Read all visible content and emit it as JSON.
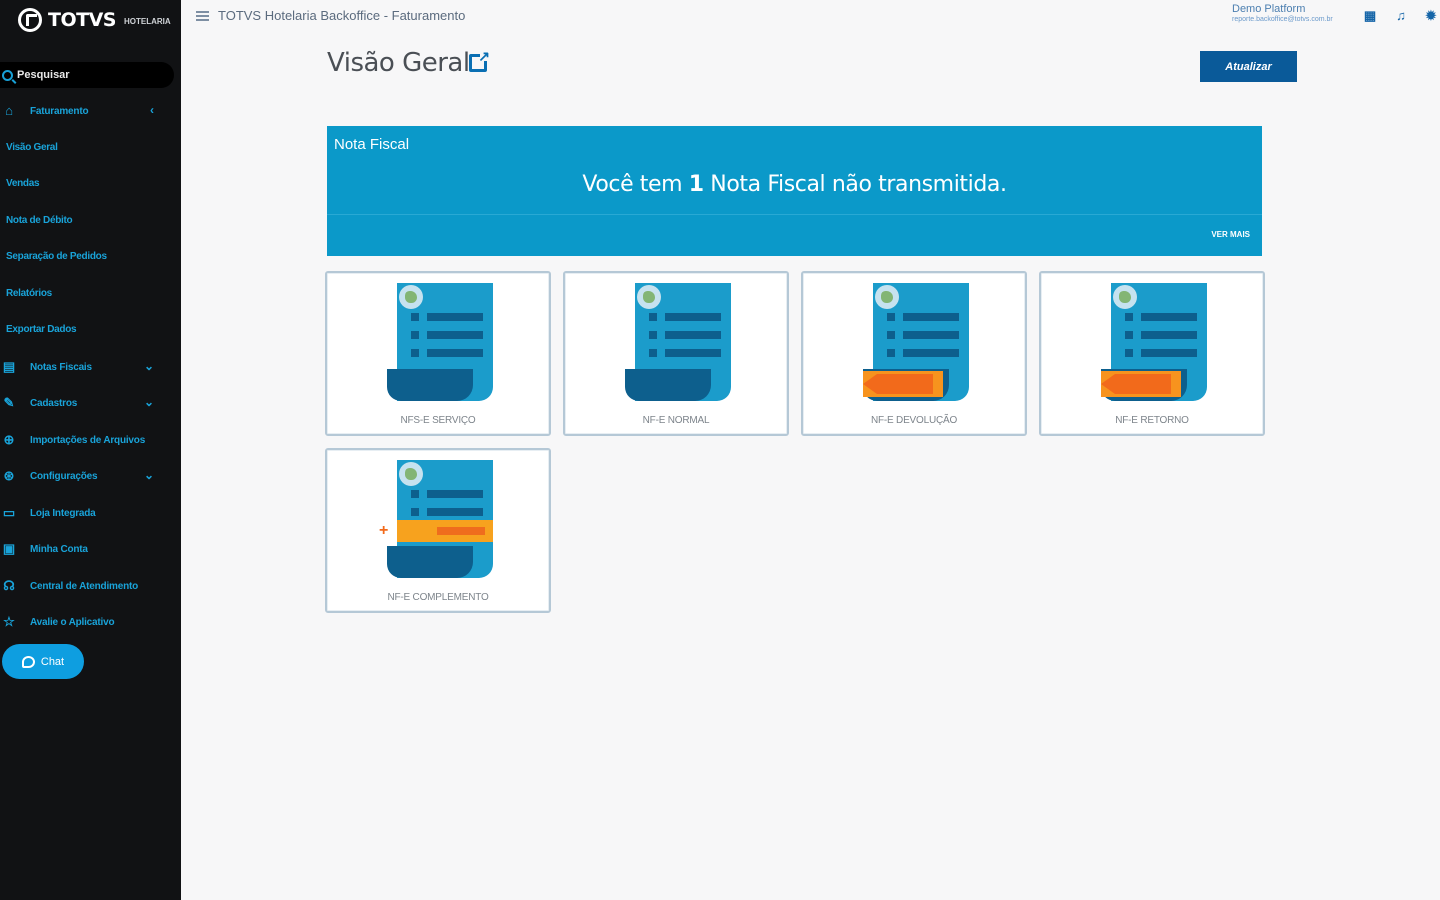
{
  "app": {
    "logo_text": "TOTVS",
    "logo_sub": "HOTELARIA"
  },
  "header": {
    "breadcrumb": "TOTVS Hotelaria Backoffice - Faturamento",
    "user_name": "Demo Platform",
    "user_email": "reporte.backoffice@totvs.com.br",
    "icons": [
      "apps-grid-icon",
      "bell-icon",
      "gear-icon"
    ]
  },
  "sidebar": {
    "search_label": "Pesquisar",
    "items": [
      {
        "label": "Faturamento",
        "icon": "home-icon",
        "chevron": "‹"
      },
      {
        "label": "Notas Fiscais",
        "icon": "invoice-icon",
        "chevron": "⌄"
      },
      {
        "label": "Cadastros",
        "icon": "edit-icon",
        "chevron": "⌄"
      },
      {
        "label": "Importações de Arquivos",
        "icon": "globe-icon"
      },
      {
        "label": "Configurações",
        "icon": "settings-icon",
        "chevron": "⌄"
      },
      {
        "label": "Loja Integrada",
        "icon": "store-icon"
      },
      {
        "label": "Minha Conta",
        "icon": "card-icon"
      },
      {
        "label": "Central de Atendimento",
        "icon": "headset-icon"
      },
      {
        "label": "Avalie o Aplicativo",
        "icon": "star-icon"
      }
    ],
    "subitems": [
      "Visão Geral",
      "Vendas",
      "Nota de Débito",
      "Separação de Pedidos",
      "Relatórios",
      "Exportar Dados"
    ],
    "chat_label": "Chat"
  },
  "main": {
    "title": "Visão Geral",
    "refresh_label": "Atualizar",
    "banner": {
      "title": "Nota Fiscal",
      "msg_before": "Você tem ",
      "msg_count": "1",
      "msg_after": " Nota Fiscal não transmitida.",
      "more": "VER MAIS"
    },
    "cards": [
      {
        "label": "NFS-E SERVIÇO",
        "variant": "plain"
      },
      {
        "label": "NF-E NORMAL",
        "variant": "plain"
      },
      {
        "label": "NF-E DEVOLUÇÃO",
        "variant": "arrow"
      },
      {
        "label": "NF-E RETORNO",
        "variant": "arrow"
      },
      {
        "label": "NF-E COMPLEMENTO",
        "variant": "complement"
      }
    ]
  },
  "colors": {
    "sidebar_bg": "#111214",
    "accent": "#19a3d9",
    "banner": "#0b99c9",
    "button": "#0a5a99"
  }
}
